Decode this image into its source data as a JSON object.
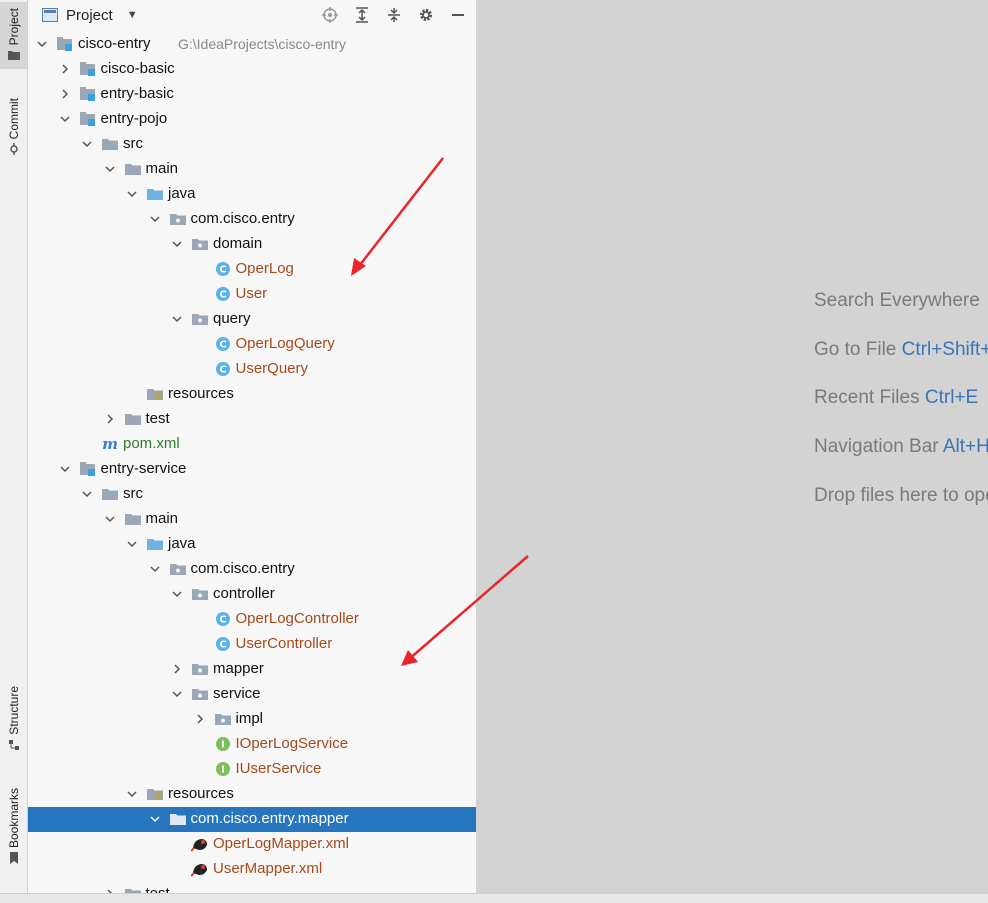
{
  "sidebar_tabs": [
    {
      "label": "Project",
      "icon": "folder-icon"
    },
    {
      "label": "Commit",
      "icon": "commit-icon"
    },
    {
      "label": "Structure",
      "icon": "structure-icon"
    },
    {
      "label": "Bookmarks",
      "icon": "bookmark-icon"
    }
  ],
  "panel": {
    "title": "Project",
    "dropdown_glyph": "▼",
    "actions": [
      "locate-icon",
      "expand-all-icon",
      "collapse-all-icon",
      "gear-icon",
      "minimize-icon"
    ]
  },
  "tree": [
    {
      "label": "cisco-entry",
      "path": "G:\\IdeaProjects\\cisco-entry",
      "type": "module",
      "depth": 0,
      "expanded": true,
      "bold": true
    },
    {
      "label": "cisco-basic",
      "type": "module",
      "depth": 1,
      "expanded": false,
      "bold": true
    },
    {
      "label": "entry-basic",
      "type": "module",
      "depth": 1,
      "expanded": false,
      "bold": true
    },
    {
      "label": "entry-pojo",
      "type": "module",
      "depth": 1,
      "expanded": true,
      "bold": true
    },
    {
      "label": "src",
      "type": "folder",
      "depth": 2,
      "expanded": true
    },
    {
      "label": "main",
      "type": "folder",
      "depth": 3,
      "expanded": true
    },
    {
      "label": "java",
      "type": "source-folder",
      "depth": 4,
      "expanded": true
    },
    {
      "label": "com.cisco.entry",
      "type": "package",
      "depth": 5,
      "expanded": true
    },
    {
      "label": "domain",
      "type": "package",
      "depth": 6,
      "expanded": true
    },
    {
      "label": "OperLog",
      "type": "class",
      "depth": 7
    },
    {
      "label": "User",
      "type": "class",
      "depth": 7
    },
    {
      "label": "query",
      "type": "package",
      "depth": 6,
      "expanded": true
    },
    {
      "label": "OperLogQuery",
      "type": "class",
      "depth": 7
    },
    {
      "label": "UserQuery",
      "type": "class",
      "depth": 7
    },
    {
      "label": "resources",
      "type": "resources",
      "depth": 4
    },
    {
      "label": "test",
      "type": "folder",
      "depth": 3,
      "expanded": false
    },
    {
      "label": "pom.xml",
      "type": "pom",
      "depth": 2
    },
    {
      "label": "entry-service",
      "type": "module",
      "depth": 1,
      "expanded": true,
      "bold": true
    },
    {
      "label": "src",
      "type": "folder",
      "depth": 2,
      "expanded": true
    },
    {
      "label": "main",
      "type": "folder",
      "depth": 3,
      "expanded": true
    },
    {
      "label": "java",
      "type": "source-folder",
      "depth": 4,
      "expanded": true
    },
    {
      "label": "com.cisco.entry",
      "type": "package",
      "depth": 5,
      "expanded": true
    },
    {
      "label": "controller",
      "type": "package",
      "depth": 6,
      "expanded": true
    },
    {
      "label": "OperLogController",
      "type": "class",
      "depth": 7
    },
    {
      "label": "UserController",
      "type": "class",
      "depth": 7
    },
    {
      "label": "mapper",
      "type": "package",
      "depth": 6,
      "expanded": false
    },
    {
      "label": "service",
      "type": "package",
      "depth": 6,
      "expanded": true
    },
    {
      "label": "impl",
      "type": "package",
      "depth": 7,
      "expanded": false
    },
    {
      "label": "IOperLogService",
      "type": "interface",
      "depth": 7
    },
    {
      "label": "IUserService",
      "type": "interface",
      "depth": 7
    },
    {
      "label": "resources",
      "type": "resources",
      "depth": 4,
      "expanded": true
    },
    {
      "label": "com.cisco.entry.mapper",
      "type": "folder",
      "depth": 5,
      "expanded": true,
      "selected": true
    },
    {
      "label": "OperLogMapper.xml",
      "type": "mybatis-xml",
      "depth": 6
    },
    {
      "label": "UserMapper.xml",
      "type": "mybatis-xml",
      "depth": 6
    },
    {
      "label": "test",
      "type": "folder",
      "depth": 3,
      "expanded": false
    }
  ],
  "editor_hints": [
    {
      "text": "Search Everywhere",
      "key": ""
    },
    {
      "text": "Go to File",
      "key": "Ctrl+Shift+N"
    },
    {
      "text": "Recent Files",
      "key": "Ctrl+E"
    },
    {
      "text": "Navigation Bar",
      "key": "Alt+Home"
    },
    {
      "text": "Drop files here to open them",
      "key": ""
    }
  ],
  "colors": {
    "selection": "#2675bf",
    "class_text": "#a44a1c",
    "pom_text": "#2d7d2d",
    "annotation_arrow": "#e8252a",
    "hint_key": "#3a74b8"
  }
}
